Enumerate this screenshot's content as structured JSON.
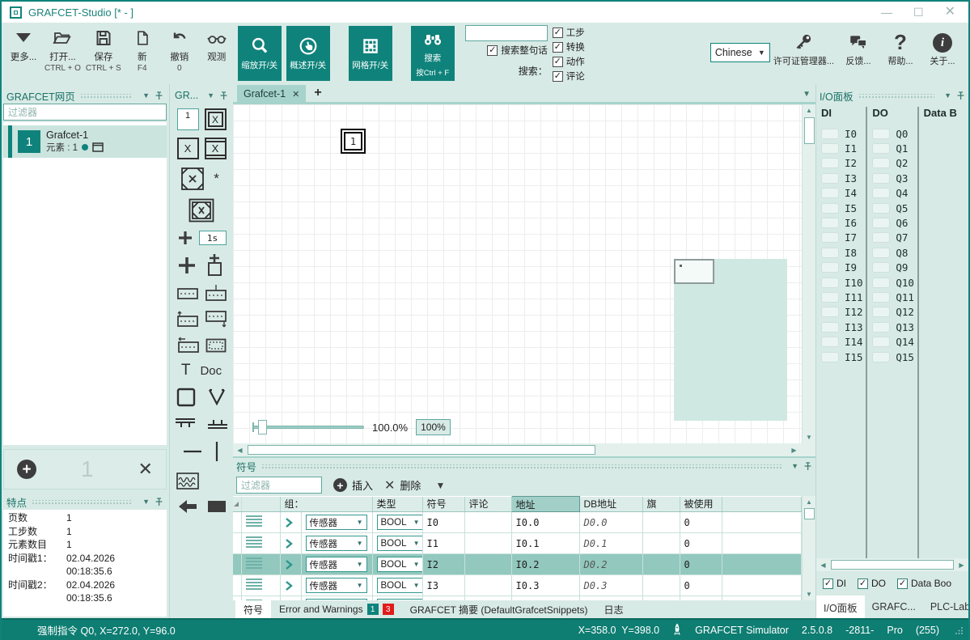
{
  "window": {
    "title": "GRAFCET-Studio [* - ]"
  },
  "toolbar": {
    "buttons": [
      {
        "label": "更多...",
        "shortcut": ""
      },
      {
        "label": "打开...",
        "shortcut": "CTRL + O"
      },
      {
        "label": "保存",
        "shortcut": "CTRL + S"
      },
      {
        "label": "新",
        "shortcut": "F4"
      },
      {
        "label": "撤销",
        "shortcut": "0"
      },
      {
        "label": "观测",
        "shortcut": ""
      }
    ],
    "toggle_zoom": "缩放开/关",
    "toggle_overview": "概述开/关",
    "toggle_grid": "网格开/关",
    "toggle_search": "搜索",
    "toggle_search_sub": "按Ctrl + F",
    "search_value": "",
    "phrase_label": "搜索整句话",
    "search_label": "搜索：",
    "filter_steps": "工步",
    "filter_transitions": "转换",
    "filter_actions": "动作",
    "filter_comments": "评论",
    "language": "Chinese",
    "license": "许可证管理器...",
    "feedback": "反馈...",
    "help": "帮助...",
    "about": "关于..."
  },
  "pages_panel": {
    "title": "GRAFCET网页",
    "filter_placeholder": "过滤器",
    "item": {
      "number": "1",
      "name": "Grafcet-1",
      "subtitle": "元素 : 1"
    }
  },
  "action_bar": {
    "count": "1"
  },
  "features": {
    "title": "特点",
    "rows": [
      [
        "页数",
        "1"
      ],
      [
        "工步数",
        "1"
      ],
      [
        "元素数目",
        "1"
      ],
      [
        "时间戳1：",
        "02.04.2026 00:18:35.6"
      ],
      [
        "时间戳2：",
        "02.04.2026 00:18:35.6"
      ]
    ]
  },
  "palette": {
    "title": "GR...",
    "step_number": "1",
    "x": "X",
    "star": "*",
    "time_value": "1s",
    "text_label": "T",
    "doc_label": "Doc"
  },
  "canvas": {
    "tab": "Grafcet-1",
    "step_number": "1",
    "zoom_text": "100.0%",
    "zoom_button": "100%"
  },
  "symbols": {
    "title": "符号",
    "filter_placeholder": "过滤器",
    "insert": "插入",
    "delete": "删除",
    "columns": {
      "group": "组：",
      "type": "类型",
      "symbol": "符号",
      "comment": "评论",
      "address": "地址",
      "db": "DB地址",
      "flag": "旗",
      "used": "被使用"
    },
    "rows": [
      {
        "group": "传感器",
        "type": "BOOL",
        "symbol": "I0",
        "comment": "",
        "address": "I0.0",
        "db": "D0.0",
        "flag": "",
        "used": "0",
        "selected": false,
        "partial": false
      },
      {
        "group": "传感器",
        "type": "BOOL",
        "symbol": "I1",
        "comment": "",
        "address": "I0.1",
        "db": "D0.1",
        "flag": "",
        "used": "0",
        "selected": false,
        "partial": false
      },
      {
        "group": "传感器",
        "type": "BOOL",
        "symbol": "I2",
        "comment": "",
        "address": "I0.2",
        "db": "D0.2",
        "flag": "",
        "used": "0",
        "selected": true,
        "partial": false
      },
      {
        "group": "传感器",
        "type": "BOOL",
        "symbol": "I3",
        "comment": "",
        "address": "I0.3",
        "db": "D0.3",
        "flag": "",
        "used": "0",
        "selected": false,
        "partial": false
      },
      {
        "group": "传感器",
        "type": "BOOL",
        "symbol": "",
        "comment": "",
        "address": "",
        "db": "",
        "flag": "",
        "used": "",
        "selected": false,
        "partial": true
      }
    ]
  },
  "bottom_tabs": {
    "symbols": "符号",
    "errors": "Error and Warnings",
    "badge_teal": "1",
    "badge_red": "3",
    "snippets": "GRAFCET 摘要 (DefaultGrafcetSnippets)",
    "log": "日志"
  },
  "io_panel": {
    "title": "I/O面板",
    "di_header": "DI",
    "do_header": "DO",
    "data_header": "Data B",
    "di": [
      "I0",
      "I1",
      "I2",
      "I3",
      "I4",
      "I5",
      "I6",
      "I7",
      "I8",
      "I9",
      "I10",
      "I11",
      "I12",
      "I13",
      "I14",
      "I15"
    ],
    "do": [
      "Q0",
      "Q1",
      "Q2",
      "Q3",
      "Q4",
      "Q5",
      "Q6",
      "Q7",
      "Q8",
      "Q9",
      "Q10",
      "Q11",
      "Q12",
      "Q13",
      "Q14",
      "Q15"
    ],
    "check_di": "DI",
    "check_do": "DO",
    "check_data": "Data Boo",
    "tab_io": "I/O面板",
    "tab_grafcet": "GRAFC...",
    "tab_plclab": "PLC-Lab"
  },
  "statusbar": {
    "left": "强制指令 Q0, X=272.0, Y=96.0",
    "coords": "X=358.0  Y=398.0",
    "sim": "GRAFCET Simulator",
    "version": "2.5.0.8",
    "build": "-2811-",
    "edition": "Pro",
    "mem": "(255)"
  }
}
